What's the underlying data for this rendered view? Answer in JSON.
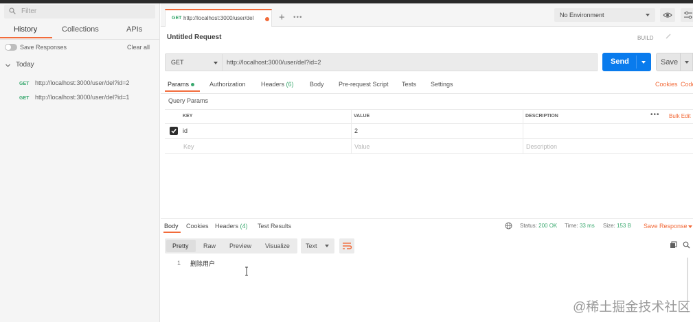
{
  "sidebar": {
    "filter_placeholder": "Filter",
    "tabs": [
      "History",
      "Collections",
      "APIs"
    ],
    "save_responses_label": "Save Responses",
    "clear_all_label": "Clear all",
    "group_label": "Today",
    "items": [
      {
        "method": "GET",
        "url": "http://localhost:3000/user/del?id=2"
      },
      {
        "method": "GET",
        "url": "http://localhost:3000/user/del?id=1"
      }
    ]
  },
  "tabbar": {
    "active_tab": {
      "method": "GET",
      "title": "http://localhost:3000/user/del"
    },
    "environment": "No Environment"
  },
  "request": {
    "title": "Untitled Request",
    "build_label": "BUILD",
    "method": "GET",
    "url": "http://localhost:3000/user/del?id=2",
    "send_label": "Send",
    "save_label": "Save",
    "tabs": {
      "params": "Params",
      "authorization": "Authorization",
      "headers": "Headers",
      "headers_count": "(6)",
      "body": "Body",
      "prerequest": "Pre-request Script",
      "tests": "Tests",
      "settings": "Settings"
    },
    "cookies_link": "Cookies",
    "code_link": "Code",
    "query_params_title": "Query Params",
    "table": {
      "headers": [
        "KEY",
        "VALUE",
        "DESCRIPTION"
      ],
      "bulk_edit": "Bulk Edit",
      "rows": [
        {
          "checked": true,
          "key": "id",
          "value": "2",
          "description": ""
        }
      ],
      "placeholders": {
        "key": "Key",
        "value": "Value",
        "description": "Description"
      }
    }
  },
  "response": {
    "tabs": {
      "body": "Body",
      "cookies": "Cookies",
      "headers": "Headers",
      "headers_count": "(4)",
      "test_results": "Test Results"
    },
    "status_label": "Status:",
    "status_value": "200 OK",
    "time_label": "Time:",
    "time_value": "33 ms",
    "size_label": "Size:",
    "size_value": "153 B",
    "save_response_label": "Save Response",
    "view_modes": [
      "Pretty",
      "Raw",
      "Preview",
      "Visualize"
    ],
    "format": "Text",
    "lines": [
      {
        "no": "1",
        "text": "删除用户"
      }
    ]
  },
  "watermark": "@稀土掘金技术社区",
  "colors": {
    "accent": "#f26b3a",
    "send": "#097bed",
    "get": "#39a86e"
  }
}
